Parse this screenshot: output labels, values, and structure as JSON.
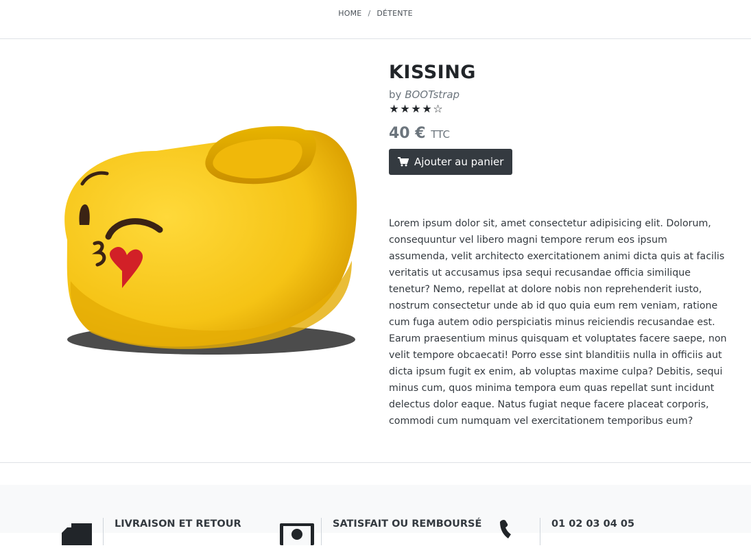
{
  "breadcrumb": {
    "home": "HOME",
    "separator": "/",
    "current": "DÉTENTE"
  },
  "product": {
    "title": "KISSING",
    "by_prefix": "by",
    "brand": "BOOTstrap",
    "rating": 4,
    "rating_max": 5,
    "price": "40 €",
    "price_suffix": "TTC",
    "cart_button": "Ajouter au panier",
    "description": "Lorem ipsum dolor sit, amet consectetur adipisicing elit. Dolorum, consequuntur vel libero magni tempore rerum eos ipsum assumenda, velit architecto exercitationem animi dicta quis at facilis veritatis ut accusamus ipsa sequi recusandae officia similique tenetur? Nemo, repellat at dolore nobis non reprehenderit iusto, nostrum consectetur unde ab id quo quia eum rem veniam, ratione cum fuga autem odio perspiciatis minus reiciendis recusandae est. Earum praesentium minus quisquam et voluptates facere saepe, non velit tempore obcaecati! Porro esse sint blanditiis nulla in officiis aut dicta ipsum fugit ex enim, ab voluptas maxime culpa? Debitis, sequi minus cum, quos minima tempora eum quas repellat sunt incidunt delectus dolor eaque. Natus fugiat neque facere placeat corporis, commodi cum numquam vel exercitationem temporibus eum?",
    "image_icon": "emoji-slipper-image"
  },
  "footer": {
    "features": [
      {
        "icon": "truck-icon",
        "label": "LIVRAISON ET RETOUR"
      },
      {
        "icon": "money-icon",
        "label": "SATISFAIT OU REMBOURSÉ"
      },
      {
        "icon": "phone-icon",
        "label": "01 02 03 04 05"
      }
    ]
  },
  "colors": {
    "dark": "#343a40",
    "muted": "#6c757d",
    "footer_bg": "#f8f9fa",
    "slipper_yellow": "#f6c417"
  }
}
